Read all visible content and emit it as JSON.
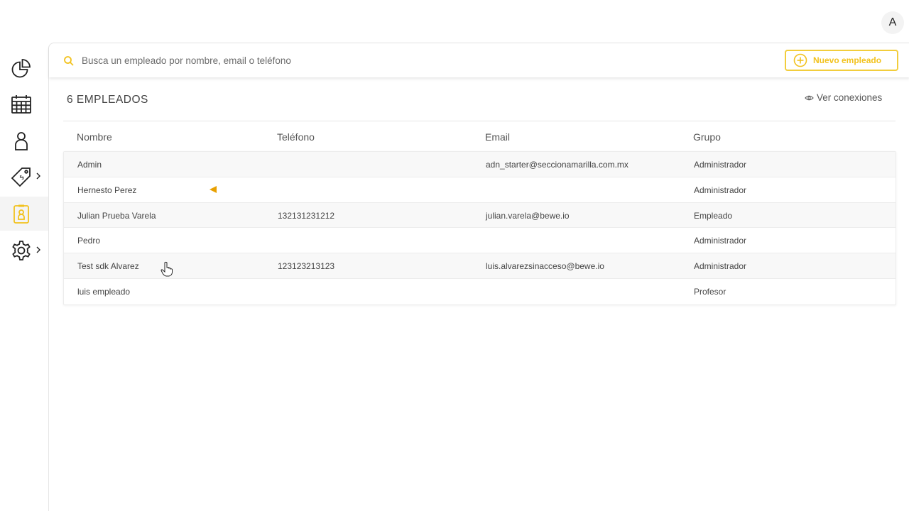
{
  "user": {
    "avatar_letter": "A"
  },
  "sidebar": {
    "items": [
      {
        "name": "reports",
        "icon": "pie-chart-icon"
      },
      {
        "name": "calendar",
        "icon": "calendar-icon"
      },
      {
        "name": "clients",
        "icon": "person-icon"
      },
      {
        "name": "pricing",
        "icon": "price-tag-icon",
        "has_submenu": true
      },
      {
        "name": "employees",
        "icon": "employee-badge-icon",
        "active": true
      },
      {
        "name": "settings",
        "icon": "gear-icon",
        "has_submenu": true
      }
    ]
  },
  "search": {
    "placeholder": "Busca un empleado por nombre, email o teléfono",
    "value": ""
  },
  "toolbar": {
    "new_employee_label": "Nuevo empleado"
  },
  "summary": {
    "count_label": "6 EMPLEADOS",
    "connections_label": "Ver conexiones"
  },
  "table": {
    "headers": [
      "Nombre",
      "Teléfono",
      "Email",
      "Grupo"
    ],
    "rows": [
      {
        "name": "Admin",
        "phone": "",
        "email": "adn_starter@seccionamarilla.com.mx",
        "group": "Administrador"
      },
      {
        "name": "Hernesto Perez",
        "phone": "",
        "email": "",
        "group": "Administrador"
      },
      {
        "name": "Julian Prueba Varela",
        "phone": "132131231212",
        "email": "julian.varela@bewe.io",
        "group": "Empleado"
      },
      {
        "name": "Pedro",
        "phone": "",
        "email": "",
        "group": "Administrador"
      },
      {
        "name": "Test sdk Alvarez",
        "phone": "123123213123",
        "email": "luis.alvarezsinacceso@bewe.io",
        "group": "Administrador"
      },
      {
        "name": "luis empleado",
        "phone": "",
        "email": "",
        "group": "Profesor"
      }
    ]
  },
  "colors": {
    "accent": "#f2c21e",
    "accent_border": "#f2cd3c",
    "marker": "#e8a000",
    "icon_stroke": "#222222"
  }
}
